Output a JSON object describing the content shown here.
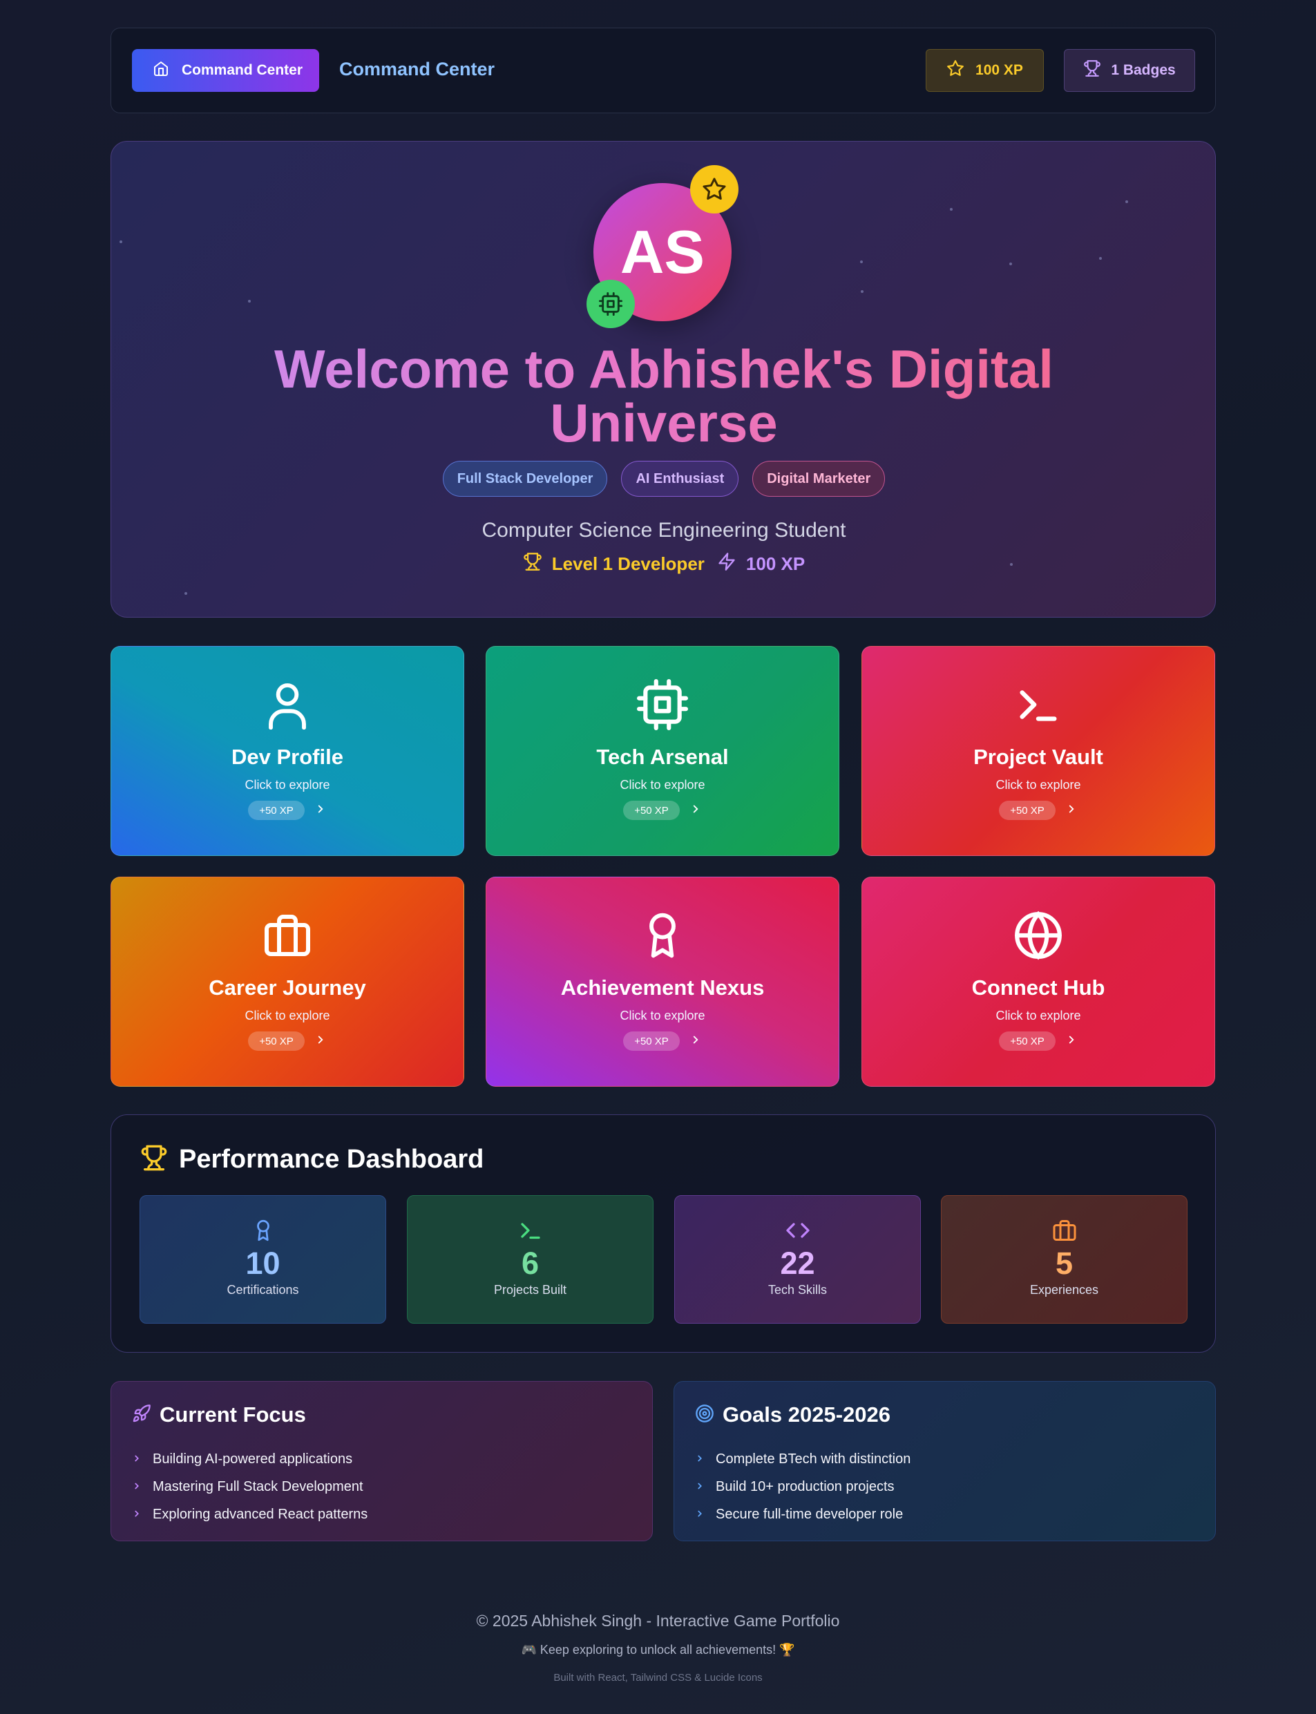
{
  "nav": {
    "home_button_label": "Command Center",
    "title": "Command Center",
    "xp_label": "100 XP",
    "badges_label": "1 Badges"
  },
  "hero": {
    "avatar_initials": "AS",
    "title": "Welcome to Abhishek's Digital Universe",
    "roles": [
      "Full Stack Developer",
      "AI Enthusiast",
      "Digital Marketer"
    ],
    "subtitle": "Computer Science Engineering Student",
    "level_label": "Level 1 Developer",
    "xp_label": "100 XP"
  },
  "cards": [
    {
      "name": "Dev Profile",
      "hint": "Click to explore",
      "xp": "+50 XP",
      "icon": "user-icon"
    },
    {
      "name": "Tech Arsenal",
      "hint": "Click to explore",
      "xp": "+50 XP",
      "icon": "cpu-icon"
    },
    {
      "name": "Project Vault",
      "hint": "Click to explore",
      "xp": "+50 XP",
      "icon": "terminal-icon"
    },
    {
      "name": "Career Journey",
      "hint": "Click to explore",
      "xp": "+50 XP",
      "icon": "briefcase-icon"
    },
    {
      "name": "Achievement Nexus",
      "hint": "Click to explore",
      "xp": "+50 XP",
      "icon": "award-icon"
    },
    {
      "name": "Connect Hub",
      "hint": "Click to explore",
      "xp": "+50 XP",
      "icon": "globe-icon"
    }
  ],
  "dashboard": {
    "title": "Performance Dashboard",
    "stats": [
      {
        "value": "10",
        "label": "Certifications",
        "icon": "award-icon"
      },
      {
        "value": "6",
        "label": "Projects Built",
        "icon": "terminal-icon"
      },
      {
        "value": "22",
        "label": "Tech Skills",
        "icon": "code-icon"
      },
      {
        "value": "5",
        "label": "Experiences",
        "icon": "briefcase-icon"
      }
    ]
  },
  "focus": {
    "title": "Current Focus",
    "items": [
      "Building AI-powered applications",
      "Mastering Full Stack Development",
      "Exploring advanced React patterns"
    ]
  },
  "goals": {
    "title": "Goals 2025-2026",
    "items": [
      "Complete BTech with distinction",
      "Build 10+ production projects",
      "Secure full-time developer role"
    ]
  },
  "footer": {
    "copyright": "© 2025 Abhishek Singh - Interactive Game Portfolio",
    "tagline": "🎮 Keep exploring to unlock all achievements! 🏆",
    "built_with": "Built with React, Tailwind CSS & Lucide Icons"
  },
  "colors": {
    "accent_blue": "#3b5bf0",
    "accent_purple": "#8e35e8",
    "xp_gold": "#fbcb2a"
  }
}
